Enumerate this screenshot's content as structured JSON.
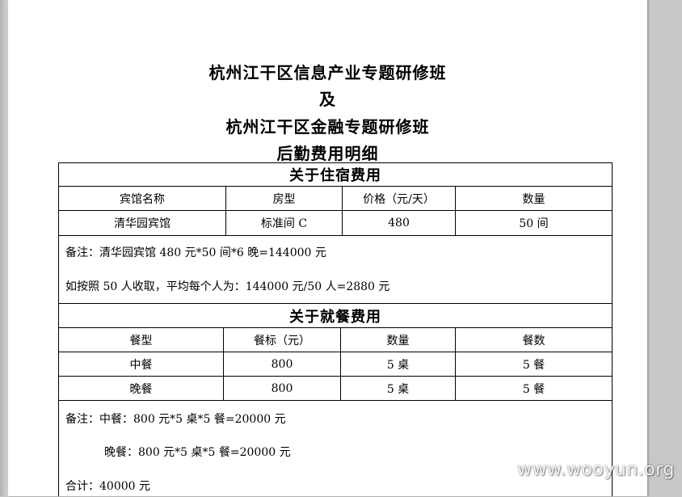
{
  "document": {
    "title_line1": "杭州江干区信息产业专题研修班",
    "title_line2": "及",
    "title_line3": "杭州江干区金融专题研修班",
    "title_line4": "后勤费用明细"
  },
  "accommodation": {
    "section_title": "关于住宿费用",
    "headers": [
      "宾馆名称",
      "房型",
      "价格（元/天）",
      "数量"
    ],
    "rows": [
      [
        "清华园宾馆",
        "标准间 C",
        "480",
        "50 间"
      ]
    ],
    "note_line1": "备注：清华园宾馆 480 元*50 间*6 晚=144000 元",
    "note_line2": "如按照 50 人收取，平均每个人为：144000 元/50 人=2880 元"
  },
  "dining": {
    "section_title": "关于就餐费用",
    "headers": [
      "餐型",
      "餐标（元）",
      "数量",
      "餐数"
    ],
    "rows": [
      [
        "中餐",
        "800",
        "5 桌",
        "5 餐"
      ],
      [
        "晚餐",
        "800",
        "5 桌",
        "5 餐"
      ]
    ],
    "note_line1": "备注：中餐：800 元*5 桌*5 餐=20000 元",
    "note_line2": "晚餐：800 元*5 桌*5 餐=20000 元",
    "note_line3": "合计：40000 元"
  },
  "watermark": {
    "text": "www.wooyun.org"
  }
}
